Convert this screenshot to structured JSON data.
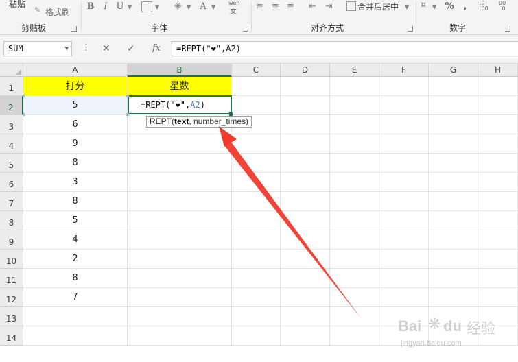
{
  "ribbon": {
    "clipboard": {
      "paste_label": "粘贴",
      "format_painter_label": "格式刷",
      "group_label": "剪贴板"
    },
    "font": {
      "bold": "B",
      "italic": "I",
      "underline": "U",
      "font_color": "A",
      "phonetic": "wén",
      "phonetic_sub": "文",
      "group_label": "字体"
    },
    "alignment": {
      "merge_center_label": "合并后居中",
      "group_label": "对齐方式"
    },
    "number": {
      "percent": "%",
      "comma": ",",
      "dec_inc": ".0",
      "dec_inc2": ".00",
      "dec_dec": "00",
      "dec_dec2": ".0",
      "group_label": "数字"
    }
  },
  "formula_bar": {
    "name_box": "SUM",
    "cancel_icon": "✕",
    "confirm_icon": "✓",
    "fx_icon": "fx",
    "formula_prefix": "=REPT(\"❤\",",
    "formula_ref": "A2",
    "formula_suffix": ")",
    "formula": "=REPT(\"❤\",A2)"
  },
  "sheet": {
    "columns": [
      "A",
      "B",
      "C",
      "D",
      "E",
      "F",
      "G",
      "H"
    ],
    "rows": [
      "1",
      "2",
      "3",
      "4",
      "5",
      "6",
      "7",
      "8",
      "9",
      "10",
      "11",
      "12",
      "13",
      "14"
    ],
    "active_column": "B",
    "active_row": "2",
    "header_a": "打分",
    "header_b": "星数",
    "scores": [
      "5",
      "6",
      "9",
      "8",
      "3",
      "8",
      "5",
      "4",
      "2",
      "8",
      "7"
    ],
    "editing_cell": {
      "prefix": "=REPT(\"❤\",",
      "ref": "A2",
      "suffix": ")"
    },
    "tooltip": {
      "fn": "REPT(",
      "arg1": "text",
      "rest": ", number_times)"
    },
    "fill_color": "#ffff00",
    "selection_color": "#217346",
    "arrow_color": "#f03a2e"
  },
  "watermark": {
    "brand": "Bai",
    "brand2": "du",
    "cn": "经验",
    "url": "jingyan.baidu.com"
  }
}
